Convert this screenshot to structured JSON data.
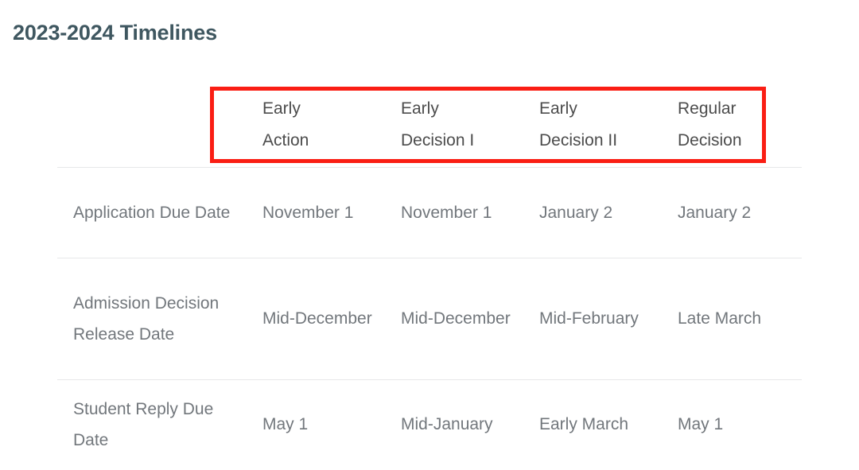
{
  "page": {
    "title": "2023-2024 Timelines"
  },
  "table": {
    "columns": [
      {
        "label": ""
      },
      {
        "label": "Early Action",
        "lines": [
          "Early",
          "Action"
        ]
      },
      {
        "label": "Early Decision I",
        "lines": [
          "Early",
          "Decision I"
        ]
      },
      {
        "label": "Early Decision II",
        "lines": [
          "Early",
          "Decision II"
        ]
      },
      {
        "label": "Regular Decision",
        "lines": [
          "Regular",
          "Decision"
        ]
      }
    ],
    "rows": [
      {
        "label": "Application Due Date",
        "cells": [
          "November 1",
          "November 1",
          "January 2",
          "January 2"
        ]
      },
      {
        "label": "Admission Decision Release Date",
        "cells": [
          "Mid-December",
          "Mid-December",
          "Mid-February",
          "Late March"
        ]
      },
      {
        "label": "Student Reply Due Date",
        "cells": [
          "May 1",
          "Mid-January",
          "Early March",
          "May 1"
        ]
      }
    ]
  },
  "annotation": {
    "name": "header-row-highlight",
    "color": "#fa1e14",
    "target": "column header row"
  },
  "colors": {
    "title": "#3f5760",
    "header_text": "#4c4c4c",
    "body_text": "#72777c",
    "row_divider": "#e7e8e9",
    "background": "#ffffff",
    "highlight": "#fa1e14"
  }
}
